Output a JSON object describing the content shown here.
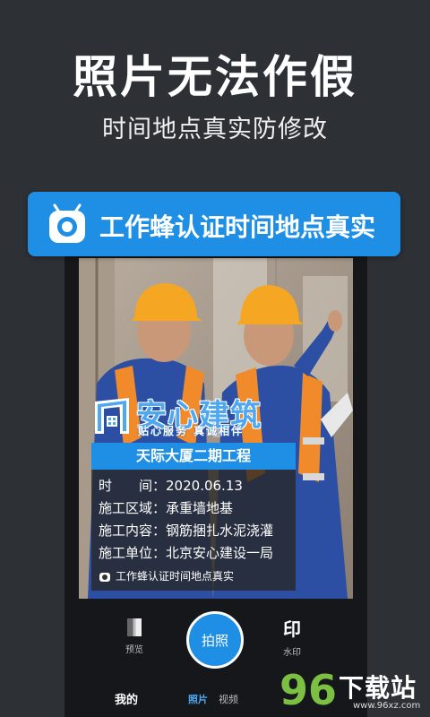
{
  "headline": "照片无法作假",
  "subline": "时间地点真实防修改",
  "banner": {
    "text": "工作蜂认证时间地点真实"
  },
  "watermark": {
    "brand_name": "安心建筑",
    "brand_slogan": "贴心服务 真诚相伴",
    "project_name": "天际大厦二期工程",
    "rows": [
      {
        "label": "时　　间：",
        "value": "2020.06.13"
      },
      {
        "label": "施工区域：",
        "value": "承重墙地基"
      },
      {
        "label": "施工内容：",
        "value": "钢筋捆扎水泥浇灌"
      },
      {
        "label": "施工单位：",
        "value": "北京安心建设一局"
      }
    ],
    "footer_text": "工作蜂认证时间地点真实"
  },
  "camera": {
    "preview_label": "预览",
    "shutter_label": "拍照",
    "stamp_glyph": "印",
    "stamp_label": "水印",
    "tabs": {
      "mine": "我的",
      "photo": "照片",
      "video": "视频"
    }
  },
  "site_logo": {
    "text": "下载站",
    "url": "www.96xz.com",
    "number": "96"
  },
  "colors": {
    "accent": "#1f8fe6",
    "background": "#2d3035",
    "vest": "#f08a2a",
    "helmet": "#f5a623"
  },
  "icons": {
    "banner": "camera-app-icon",
    "brand": "building-logo-icon",
    "footer": "camera-small-icon"
  }
}
